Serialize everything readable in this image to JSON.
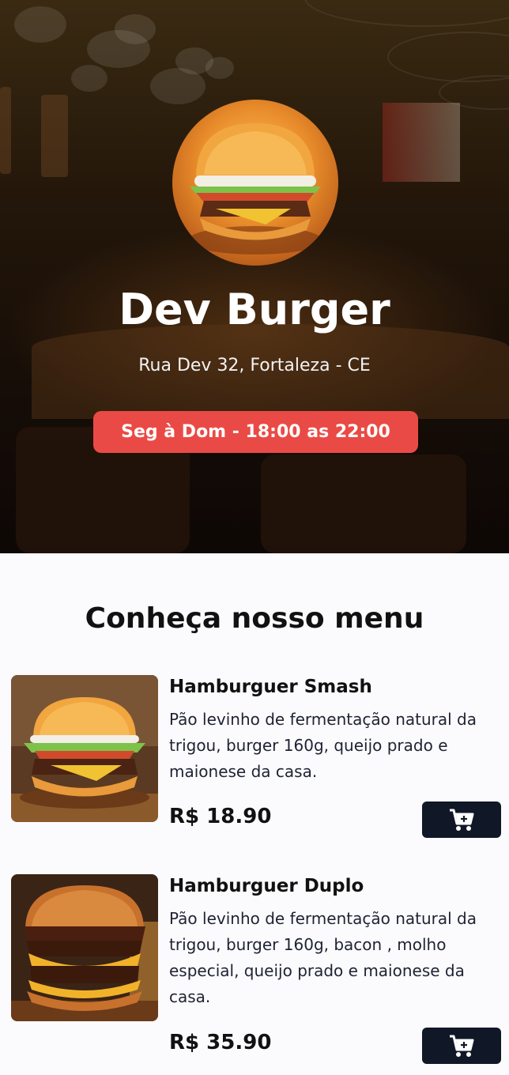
{
  "header": {
    "restaurant_name": "Dev Burger",
    "address": "Rua Dev 32, Fortaleza - CE",
    "hours": "Seg à Dom - 18:00 as 22:00",
    "hours_color": "#ea4a45"
  },
  "menu": {
    "title": "Conheça nosso menu",
    "items": [
      {
        "name": "Hamburguer Smash",
        "description": "Pão levinho de fermentação natural da trigou, burger 160g, queijo prado e maionese da casa.",
        "price": "R$ 18.90",
        "image_icon": "burger-smash-photo",
        "cart_icon": "add-to-cart-icon"
      },
      {
        "name": "Hamburguer Duplo",
        "description": "Pão levinho de fermentação natural da trigou, burger 160g, bacon , molho especial, queijo prado e maionese da casa.",
        "price": "R$ 35.90",
        "image_icon": "burger-duplo-photo",
        "cart_icon": "add-to-cart-icon"
      }
    ]
  },
  "colors": {
    "cart_button": "#101827",
    "page_background": "#fbfbfd"
  }
}
